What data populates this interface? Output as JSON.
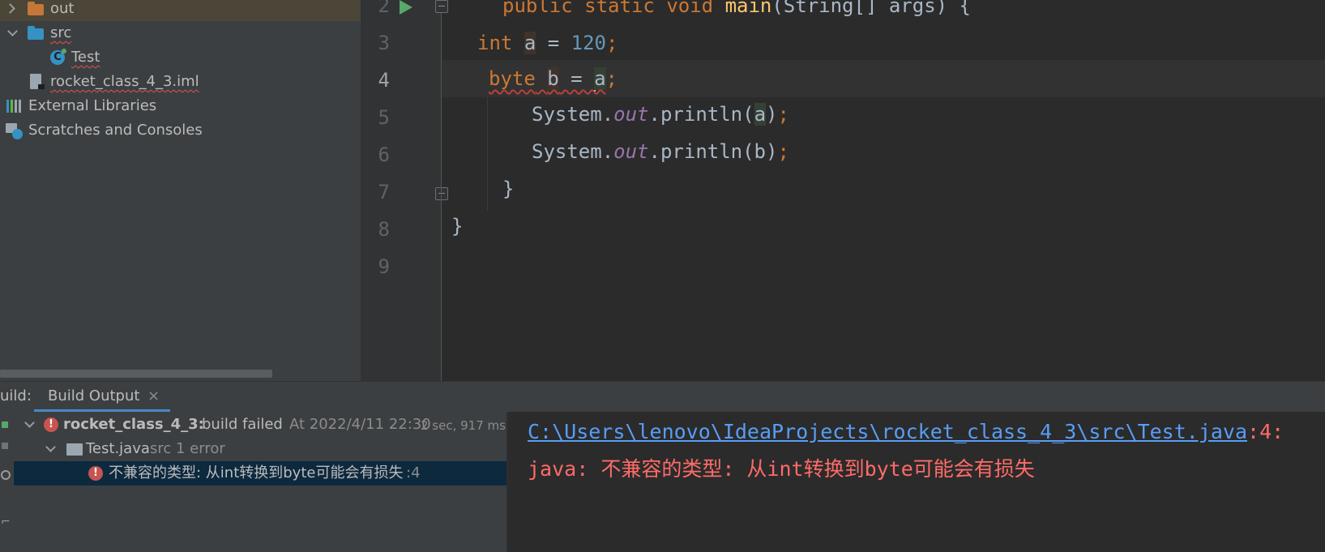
{
  "project_tree": {
    "items": [
      {
        "label": "out",
        "expanded": false,
        "icon": "folder-orange-icon",
        "selected": true
      },
      {
        "label": "src",
        "expanded": true,
        "icon": "folder-blue-icon"
      },
      {
        "label": "Test",
        "icon": "java-class-icon"
      },
      {
        "label": "rocket_class_4_3.iml",
        "icon": "iml-file-icon"
      },
      {
        "label": "External Libraries",
        "icon": "libraries-icon"
      },
      {
        "label": "Scratches and Consoles",
        "icon": "scratches-icon"
      }
    ]
  },
  "editor": {
    "line_numbers": [
      "2",
      "3",
      "4",
      "5",
      "6",
      "7",
      "8",
      "9"
    ],
    "current_line": "4",
    "lines": {
      "l2": {
        "kw1": "public",
        "kw2": "static",
        "kw3": "void",
        "method": "main",
        "rest": "(String[] args) {"
      },
      "l3": {
        "kw": "int",
        "var": "a",
        "eq": " = ",
        "num": "120",
        "semi": ";"
      },
      "l4": {
        "kw": "byte",
        "var": "b",
        "eq": " = ",
        "ref": "a",
        "semi": ";"
      },
      "l5": {
        "obj": "System.",
        "field": "out",
        "call": ".println(",
        "arg": "a",
        "close": ")",
        "semi": ";"
      },
      "l6": {
        "obj": "System.",
        "field": "out",
        "call": ".println(b)",
        "semi": ";"
      },
      "l7": {
        "brace": "}"
      },
      "l8": {
        "brace": "}"
      }
    }
  },
  "build": {
    "title": "uild:",
    "tab_label": "Build Output",
    "tree": {
      "project": "rocket_class_4_3:",
      "status": "build failed",
      "time": "At 2022/4/11 22:30",
      "duration": "2 sec, 917 ms",
      "file": "Test.java",
      "file_meta": "src 1 error",
      "error_message": "不兼容的类型: 从int转换到byte可能会有损失",
      "error_line": ":4"
    },
    "console": {
      "path": "C:\\Users\\lenovo\\IdeaProjects\\rocket_class_4_3\\src\\Test.java",
      "path_suffix": ":4:",
      "error_prefix": "java: ",
      "error_text": "不兼容的类型: 从int转换到byte可能会有损失"
    }
  },
  "colors": {
    "keyword": "#cc7832",
    "number": "#6897bb",
    "field": "#9876aa",
    "error": "#ff6b68",
    "link": "#589df6"
  }
}
